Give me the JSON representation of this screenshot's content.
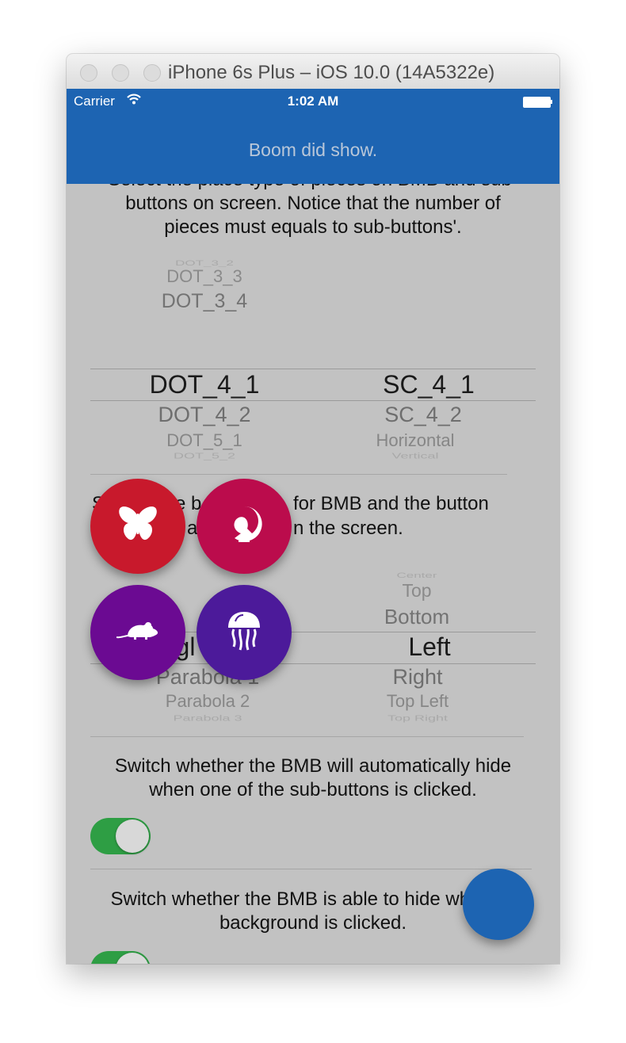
{
  "window": {
    "title": "iPhone 6s Plus – iOS 10.0 (14A5322e)"
  },
  "status_bar": {
    "carrier": "Carrier",
    "time": "1:02 AM"
  },
  "nav": {
    "title": "Boom did show."
  },
  "section_pieces": {
    "text_line1_partial": "Select the place type of pieces on BMB and sub-",
    "text_line2": "buttons on screen. Notice that the number of",
    "text_line3": "pieces must equals to sub-buttons'.",
    "left_picker": [
      "DOT_3_2",
      "DOT_3_3",
      "DOT_3_4",
      "DOT_4_1",
      "DOT_4_2",
      "DOT_5_1",
      "DOT_5_2"
    ],
    "right_picker": [
      "SC_4_1",
      "SC_4_2",
      "Horizontal",
      "Vertical"
    ]
  },
  "section_ease": {
    "text_line1_parts": [
      "S",
      "e b",
      "for BMB and the button"
    ],
    "text_line2_parts": [
      "a",
      "n the screen."
    ],
    "left_picker": [
      "gl",
      "Parabola 1",
      "Parabola 2",
      "Parabola 3"
    ],
    "right_picker": [
      "Center",
      "Top",
      "Bottom",
      "Left",
      "Right",
      "Top Left",
      "Top Right"
    ]
  },
  "section_autohide": {
    "text_line1": "Switch whether the BMB will automatically hide",
    "text_line2": "when one of the sub-buttons is clicked.",
    "toggle_on": true
  },
  "section_bghide": {
    "text_line1": "Switch whether the BMB is able to hide when its",
    "text_line2": "background is clicked.",
    "toggle_on": true
  },
  "boom_buttons": [
    {
      "icon": "butterfly-icon",
      "color": "#c8192c"
    },
    {
      "icon": "peacock-icon",
      "color": "#bb0c4c"
    },
    {
      "icon": "mouse-icon",
      "color": "#6b0a92"
    },
    {
      "icon": "jellyfish-icon",
      "color": "#4c1a9a"
    }
  ],
  "colors": {
    "nav": "#1d64b2",
    "toggle_on": "#2e9e44",
    "fab": "#1d64b2"
  }
}
